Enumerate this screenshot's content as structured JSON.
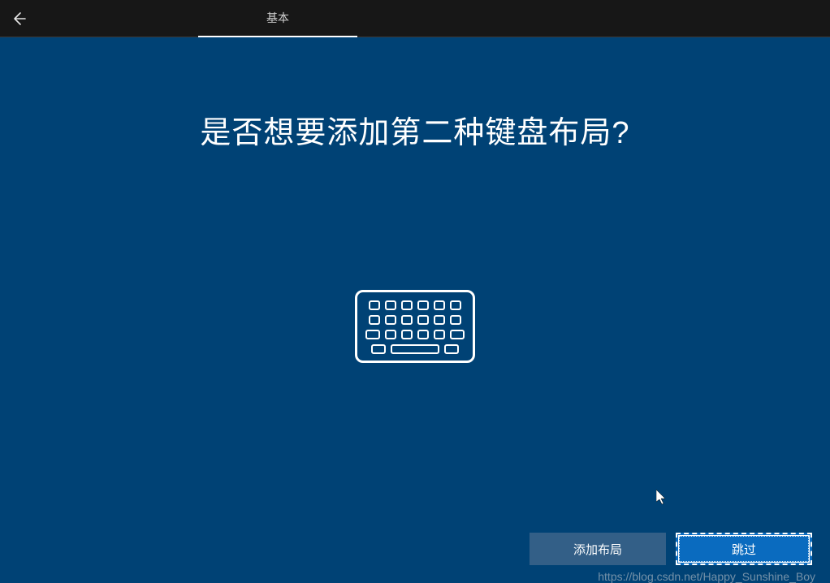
{
  "header": {
    "tab_label": "基本"
  },
  "main": {
    "title": "是否想要添加第二种键盘布局?"
  },
  "footer": {
    "add_layout_label": "添加布局",
    "skip_label": "跳过"
  },
  "watermark": "https://blog.csdn.net/Happy_Sunshine_Boy"
}
